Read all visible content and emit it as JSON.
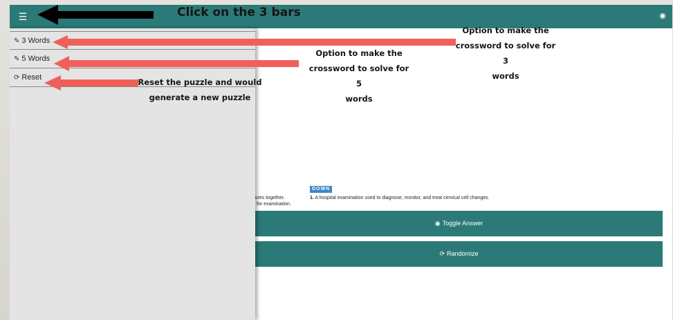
{
  "colors": {
    "teal": "#2b7a78",
    "arrow_red": "#f0605a",
    "arrow_black": "#000000",
    "sidebar_bg": "#e4e4e4",
    "down_badge": "#3d86c6"
  },
  "topbar": {
    "menu_icon": "hamburger-icon",
    "visibility_icon": "eye-icon"
  },
  "sidebar": {
    "items": [
      {
        "icon": "edit-icon",
        "label": "3 Words"
      },
      {
        "icon": "edit-icon",
        "label": "5 Words"
      },
      {
        "icon": "refresh-icon",
        "label": "Reset"
      }
    ]
  },
  "clues": {
    "across_partial_1": "ructures together.",
    "across_partial_2": "for examination.",
    "down_heading": "DOWN",
    "down_number": "1.",
    "down_text": "A hospital examination used to diagnose, monitor, and treat cervical cell changes."
  },
  "buttons": {
    "toggle_answer": "Toggle Answer",
    "toggle_icon": "eye-icon",
    "randomize": "Randomize",
    "randomize_icon": "refresh-icon"
  },
  "annotations": {
    "menu_note": "Click on the 3 bars",
    "three_words_note_l1": "Option to make the",
    "three_words_note_l2": "crossword to solve for 3",
    "three_words_note_l3": "words",
    "five_words_note_l1": "Option to make the",
    "five_words_note_l2": "crossword to solve for 5",
    "five_words_note_l3": "words",
    "reset_note_l1": "Reset the puzzle and would",
    "reset_note_l2": "generate a new puzzle"
  }
}
